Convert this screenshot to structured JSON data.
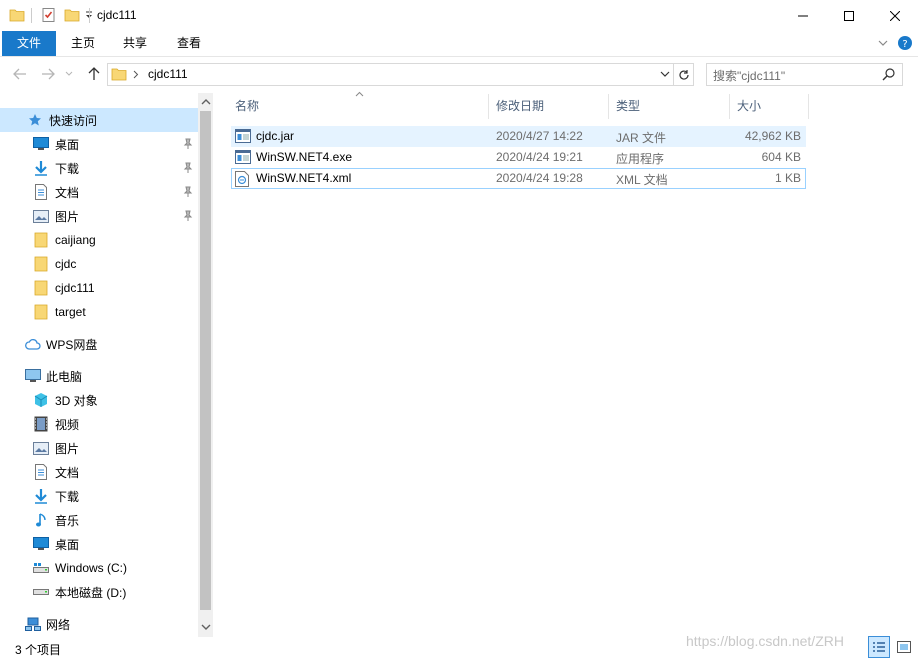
{
  "window": {
    "title": "cjdc111",
    "controls": [
      "minimize-icon",
      "maximize-icon",
      "close-icon"
    ]
  },
  "ribbon": {
    "tabs": [
      {
        "label": "文件",
        "active": true
      },
      {
        "label": "主页"
      },
      {
        "label": "共享"
      },
      {
        "label": "查看"
      }
    ]
  },
  "address": {
    "path": "cjdc111",
    "search_placeholder": "搜索\"cjdc111\""
  },
  "sidebar": {
    "quick_access": "快速访问",
    "pinned": [
      {
        "label": "桌面",
        "icon": "desktop-icon"
      },
      {
        "label": "下载",
        "icon": "download-icon"
      },
      {
        "label": "文档",
        "icon": "document-icon"
      },
      {
        "label": "图片",
        "icon": "picture-icon"
      }
    ],
    "folders": [
      {
        "label": "caijiang",
        "icon": "folder-icon"
      },
      {
        "label": "cjdc",
        "icon": "folder-icon"
      },
      {
        "label": "cjdc111",
        "icon": "folder-icon"
      },
      {
        "label": "target",
        "icon": "folder-icon"
      }
    ],
    "wps": "WPS网盘",
    "this_pc": "此电脑",
    "pc_items": [
      {
        "label": "3D 对象",
        "icon": "3d-objects-icon"
      },
      {
        "label": "视频",
        "icon": "video-icon"
      },
      {
        "label": "图片",
        "icon": "picture-icon"
      },
      {
        "label": "文档",
        "icon": "document-icon"
      },
      {
        "label": "下载",
        "icon": "download-icon"
      },
      {
        "label": "音乐",
        "icon": "music-icon"
      },
      {
        "label": "桌面",
        "icon": "desktop-icon"
      },
      {
        "label": "Windows (C:)",
        "icon": "drive-c-icon"
      },
      {
        "label": "本地磁盘 (D:)",
        "icon": "drive-d-icon"
      }
    ],
    "network": "网络"
  },
  "content": {
    "columns": {
      "name": "名称",
      "date": "修改日期",
      "type": "类型",
      "size": "大小"
    },
    "files": [
      {
        "name": "cjdc.jar",
        "date": "2020/4/27 14:22",
        "type": "JAR 文件",
        "size": "42,962 KB",
        "icon": "jar-file-icon"
      },
      {
        "name": "WinSW.NET4.exe",
        "date": "2020/4/24 19:21",
        "type": "应用程序",
        "size": "604 KB",
        "icon": "exe-file-icon"
      },
      {
        "name": "WinSW.NET4.xml",
        "date": "2020/4/24 19:28",
        "type": "XML 文档",
        "size": "1 KB",
        "icon": "xml-file-icon"
      }
    ]
  },
  "status": {
    "count": "3 个项目",
    "watermark": "https://blog.csdn.net/ZRH"
  },
  "colors": {
    "accent": "#1979ca",
    "selection": "#cce8ff",
    "folder": "#f8d775"
  }
}
